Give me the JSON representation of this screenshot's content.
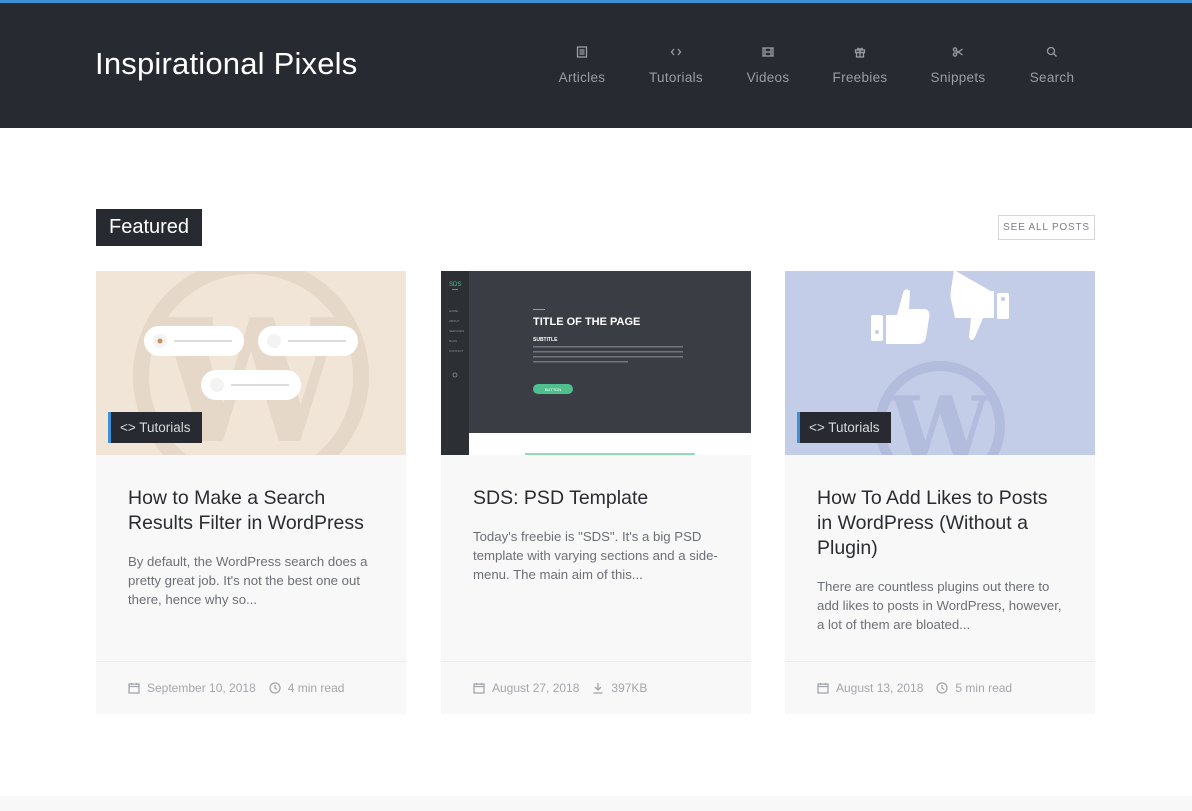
{
  "site": {
    "logo": "Inspirational Pixels",
    "accent_color": "#3d8fd6",
    "header_bg": "#272a31"
  },
  "nav": [
    {
      "label": "Articles",
      "icon": "article-icon"
    },
    {
      "label": "Tutorials",
      "icon": "code-icon"
    },
    {
      "label": "Videos",
      "icon": "film-icon"
    },
    {
      "label": "Freebies",
      "icon": "gift-icon"
    },
    {
      "label": "Snippets",
      "icon": "scissors-icon"
    },
    {
      "label": "Search",
      "icon": "search-icon"
    }
  ],
  "section": {
    "title": "Featured",
    "see_all": "SEE ALL POSTS"
  },
  "cards": [
    {
      "title": "How to Make a Search Results Filter in WordPress",
      "excerpt": "By default, the WordPress search does a pretty great job. It's not the best one out there, hence why so...",
      "badge": "Tutorials",
      "date": "September 10, 2018",
      "meta2": "4 min read",
      "meta2_icon": "clock-icon"
    },
    {
      "title": "SDS: PSD Template",
      "excerpt": "Today's freebie is \"SDS\". It's a big PSD template with varying sections and a side-menu. The main aim of this...",
      "date": "August 27, 2018",
      "meta2": "397KB",
      "meta2_icon": "download-icon",
      "preview": {
        "brand": "SDS",
        "menu": [
          "HOME",
          "ABOUT",
          "SERVICES",
          "BLOG",
          "CONTACT"
        ],
        "heading": "TITLE OF THE PAGE",
        "subtitle": "SUBTITLE",
        "button": "BUTTON"
      }
    },
    {
      "title": "How To Add Likes to Posts in WordPress (Without a Plugin)",
      "excerpt": "There are countless plugins out there to add likes to posts in WordPress, however, a lot of them are bloated...",
      "badge": "Tutorials",
      "date": "August 13, 2018",
      "meta2": "5 min read",
      "meta2_icon": "clock-icon"
    }
  ]
}
